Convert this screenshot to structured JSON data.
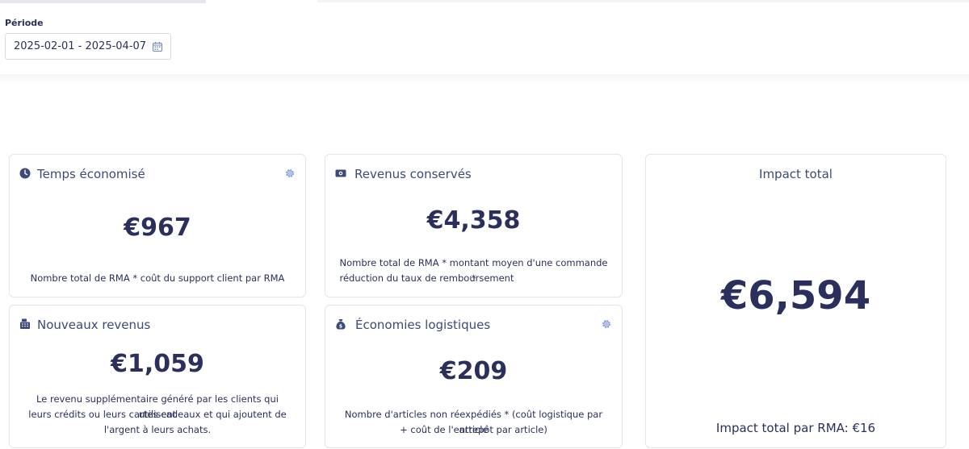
{
  "period": {
    "label": "Période",
    "date_range": "2025-02-01 - 2025-04-07"
  },
  "colors": {
    "primary": "#2b2f5c",
    "title": "#3c4a78",
    "border": "#e3e5ec"
  },
  "cards": {
    "time_saved": {
      "title": "Temps économisé",
      "value": "€967",
      "description": "Nombre total de RMA * coût du support client par RMA",
      "icon": "clock-icon"
    },
    "retained_revenue": {
      "title": "Revenus conservés",
      "value": "€4,358",
      "description_line1": "Nombre total de RMA * montant moyen d'une commande *",
      "description_line2": "réduction du taux de remboursement",
      "icon": "money-icon"
    },
    "new_revenue": {
      "title": "Nouveaux revenus",
      "value": "€1,059",
      "description_line1": "Le revenu supplémentaire généré par les clients qui utilisent",
      "description_line2": "leurs crédits ou leurs cartes-cadeaux et qui ajoutent de",
      "description_line3": "l'argent à leurs achats.",
      "icon": "register-icon"
    },
    "logistics_savings": {
      "title": "Économies logistiques",
      "value": "€209",
      "description_line1": "Nombre d'articles non réexpédiés * (coût logistique par article",
      "description_line2": "+ coût de l'entrepôt par article)",
      "icon": "money-bag-icon"
    },
    "total_impact": {
      "title": "Impact total",
      "value": "€6,594",
      "footer": "Impact total par RMA: €16"
    }
  }
}
